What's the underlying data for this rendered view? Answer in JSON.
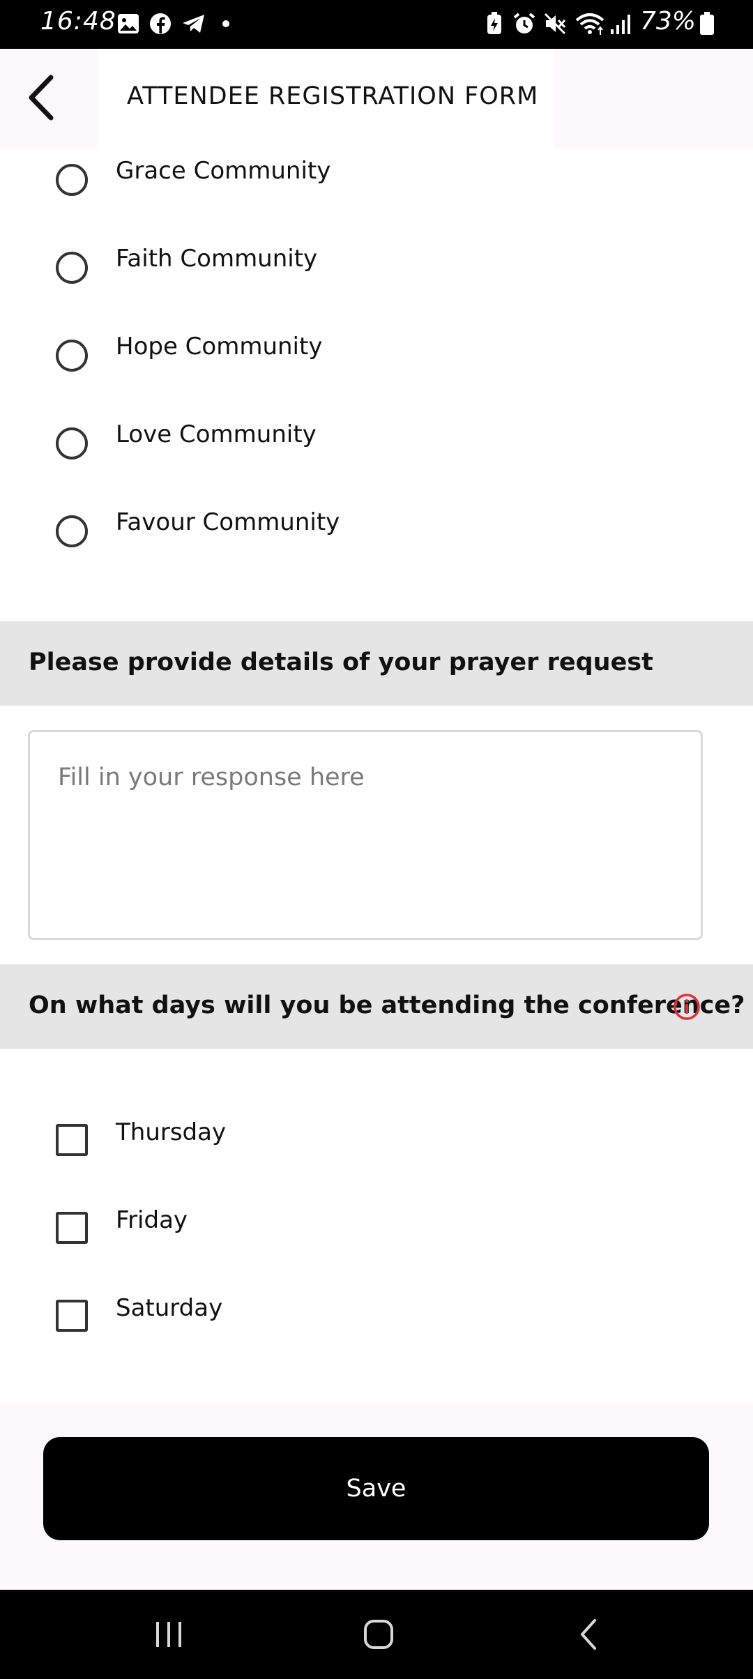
{
  "status_bar": {
    "time": "16:48",
    "battery_text": "73%",
    "left_icons": [
      "gallery-icon",
      "facebook-icon",
      "telegram-icon",
      "dot-icon"
    ],
    "right_icons": [
      "battery-saver-icon",
      "alarm-icon",
      "mute-icon",
      "wifi-icon",
      "signal-icon",
      "battery-icon"
    ]
  },
  "header": {
    "title": "ATTENDEE REGISTRATION FORM",
    "back_icon": "chevron-left-icon"
  },
  "community_options": [
    {
      "label": "Grace Community",
      "selected": false
    },
    {
      "label": "Faith Community",
      "selected": false
    },
    {
      "label": "Hope Community",
      "selected": false
    },
    {
      "label": "Love Community",
      "selected": false
    },
    {
      "label": "Favour Community",
      "selected": false
    }
  ],
  "prayer_request": {
    "title": "Please provide details of your prayer request",
    "placeholder": "Fill in your response here",
    "value": ""
  },
  "attendance": {
    "title": "On what days will you be attending the conference?",
    "info_icon": "info-icon",
    "info_color": "#e0303a",
    "days": [
      {
        "label": "Thursday",
        "checked": false
      },
      {
        "label": "Friday",
        "checked": false
      },
      {
        "label": "Saturday",
        "checked": false
      }
    ]
  },
  "save_label": "Save",
  "nav": {
    "recent_icon": "recent-apps-icon",
    "home_icon": "home-icon",
    "back_icon": "back-nav-icon"
  }
}
